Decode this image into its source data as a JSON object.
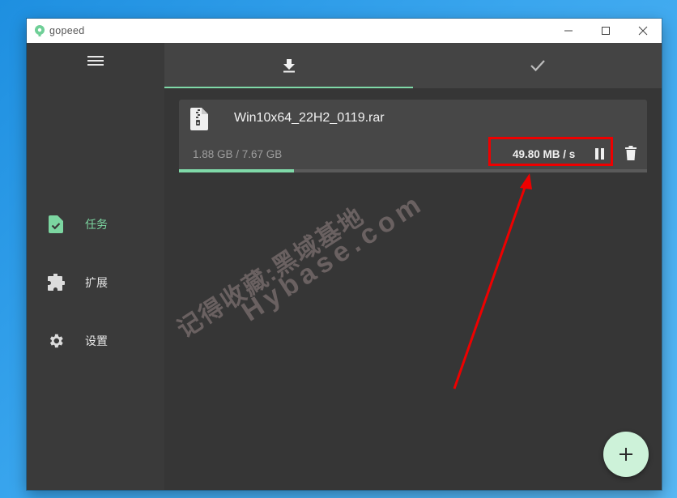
{
  "window": {
    "title": "gopeed",
    "controls": {
      "minimize": "—",
      "maximize": "☐",
      "close": "✕"
    }
  },
  "sidebar": {
    "menu_icon": "hamburger-icon",
    "items": [
      {
        "label": "任务",
        "icon": "task-file-check-icon",
        "active": true
      },
      {
        "label": "扩展",
        "icon": "puzzle-extension-icon",
        "active": false
      },
      {
        "label": "设置",
        "icon": "gear-icon",
        "active": false
      }
    ]
  },
  "tabs": [
    {
      "icon": "download-icon",
      "active": true
    },
    {
      "icon": "checkmark-icon",
      "active": false
    }
  ],
  "task": {
    "file_name": "Win10x64_22H2_0119.rar",
    "file_icon": "zip-file-icon",
    "size_text": "1.88 GB / 7.67 GB",
    "speed": "49.80 MB / s",
    "progress": 0.245,
    "actions": {
      "pause": "pause-icon",
      "delete": "trash-icon"
    }
  },
  "watermark": {
    "line1": "记得收藏:黑域基地",
    "line2": "Hybase.com"
  },
  "fab": {
    "icon": "plus-icon",
    "label": "+"
  },
  "colors": {
    "accent": "#7fd9a8",
    "annotation": "#e00000",
    "fab_bg": "#cdf2d9"
  }
}
